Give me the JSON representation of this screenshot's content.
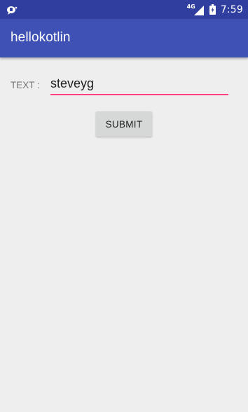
{
  "status_bar": {
    "network_type": "4G",
    "time": "7:59",
    "icons": {
      "left": "notification-bubble-icon",
      "signal": "cell-signal-icon",
      "battery": "battery-charging-icon"
    }
  },
  "app_bar": {
    "title": "hellokotlin"
  },
  "form": {
    "label": "TEXT :",
    "input_value": "steveyg",
    "submit_label": "SUBMIT"
  },
  "colors": {
    "status_bar": "#303f9f",
    "primary": "#3f51b5",
    "accent": "#ff4081",
    "background": "#eeeeee",
    "button": "#d6d7d7"
  }
}
